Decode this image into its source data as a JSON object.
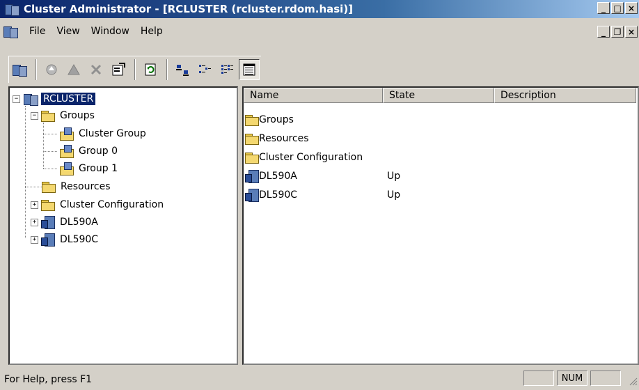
{
  "window": {
    "title": "Cluster Administrator - [RCLUSTER (rcluster.rdom.hasi)]"
  },
  "menu": [
    "File",
    "View",
    "Window",
    "Help"
  ],
  "toolbar": {
    "buttons": [
      "open-connection-icon",
      "bring-online-icon",
      "take-offline-icon",
      "delete-icon",
      "properties-icon",
      "refresh-icon",
      "large-icons-icon",
      "small-icons-icon",
      "list-view-icon",
      "details-view-icon"
    ],
    "pressed": "details-view-icon"
  },
  "tree": {
    "root": "RCLUSTER",
    "groups": "Groups",
    "group_children": [
      "Cluster Group",
      "Group 0",
      "Group 1"
    ],
    "resources": "Resources",
    "cluster_configuration": "Cluster Configuration",
    "nodes": [
      "DL590A",
      "DL590C"
    ]
  },
  "list": {
    "columns": [
      "Name",
      "State",
      "Description"
    ],
    "rows": [
      {
        "name": "Groups",
        "state": "",
        "icon": "folder-icon"
      },
      {
        "name": "Resources",
        "state": "",
        "icon": "folder-icon"
      },
      {
        "name": "Cluster Configuration",
        "state": "",
        "icon": "folder-icon"
      },
      {
        "name": "DL590A",
        "state": "Up",
        "icon": "server-icon"
      },
      {
        "name": "DL590C",
        "state": "Up",
        "icon": "server-icon"
      }
    ]
  },
  "status": {
    "help_text": "For Help, press F1",
    "num": "NUM"
  },
  "colors": {
    "titlebar_start": "#0a246a",
    "titlebar_end": "#a6caf0",
    "selection": "#0a246a",
    "chrome": "#d4d0c8"
  }
}
